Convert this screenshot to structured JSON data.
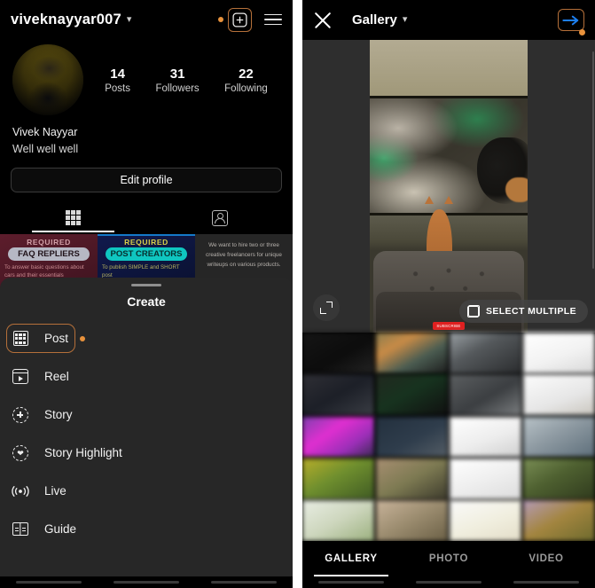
{
  "profile_panel": {
    "header": {
      "username": "viveknayyar007",
      "chevron_icon": "chevron-down-icon",
      "new_post_icon": "plus-square-icon",
      "menu_icon": "hamburger-menu-icon",
      "notification_dot_color": "#e8923c",
      "highlight_color": "#b5703a"
    },
    "stats": [
      {
        "value": "14",
        "label": "Posts"
      },
      {
        "value": "31",
        "label": "Followers"
      },
      {
        "value": "22",
        "label": "Following"
      }
    ],
    "bio": {
      "name": "Vivek Nayyar",
      "text": "Well well well"
    },
    "edit_profile_label": "Edit profile",
    "tabs": [
      {
        "name": "grid-tab",
        "icon": "grid-icon",
        "active": true
      },
      {
        "name": "tagged-tab",
        "icon": "tagged-person-icon",
        "active": false
      }
    ],
    "post_thumbnails": [
      {
        "badge": "REQUIRED",
        "pill": "FAQ REPLIERS",
        "sub": "To answer basic questions about cars and their essentials"
      },
      {
        "badge": "REQUIRED",
        "pill": "POST CREATORS",
        "sub": "To publish SIMPLE and SHORT post"
      },
      {
        "text": "We want to hire two or three creative freelancers for unique writeups on various products."
      }
    ]
  },
  "create_sheet": {
    "title": "Create",
    "items": [
      {
        "label": "Post",
        "icon": "grid-icon",
        "highlighted": true
      },
      {
        "label": "Reel",
        "icon": "reel-icon",
        "highlighted": false
      },
      {
        "label": "Story",
        "icon": "story-plus-icon",
        "highlighted": false
      },
      {
        "label": "Story Highlight",
        "icon": "story-highlight-heart-icon",
        "highlighted": false
      },
      {
        "label": "Live",
        "icon": "live-broadcast-icon",
        "highlighted": false
      },
      {
        "label": "Guide",
        "icon": "guide-book-icon",
        "highlighted": false
      }
    ]
  },
  "gallery_panel": {
    "header": {
      "close_icon": "close-x-icon",
      "title": "Gallery",
      "chevron_icon": "chevron-down-icon",
      "next_icon": "arrow-right-icon",
      "next_arrow_color": "#1d7ff0",
      "highlight_color": "#b5703a",
      "notification_dot_color": "#e8923c"
    },
    "preview": {
      "expand_icon": "expand-crop-icon",
      "select_multiple_label": "SELECT MULTIPLE",
      "select_multiple_icon": "stacked-squares-icon",
      "subscribe_badge": "SUBSCRIBE"
    },
    "tabs": [
      {
        "label": "GALLERY",
        "active": true
      },
      {
        "label": "PHOTO",
        "active": false
      },
      {
        "label": "VIDEO",
        "active": false
      }
    ]
  }
}
